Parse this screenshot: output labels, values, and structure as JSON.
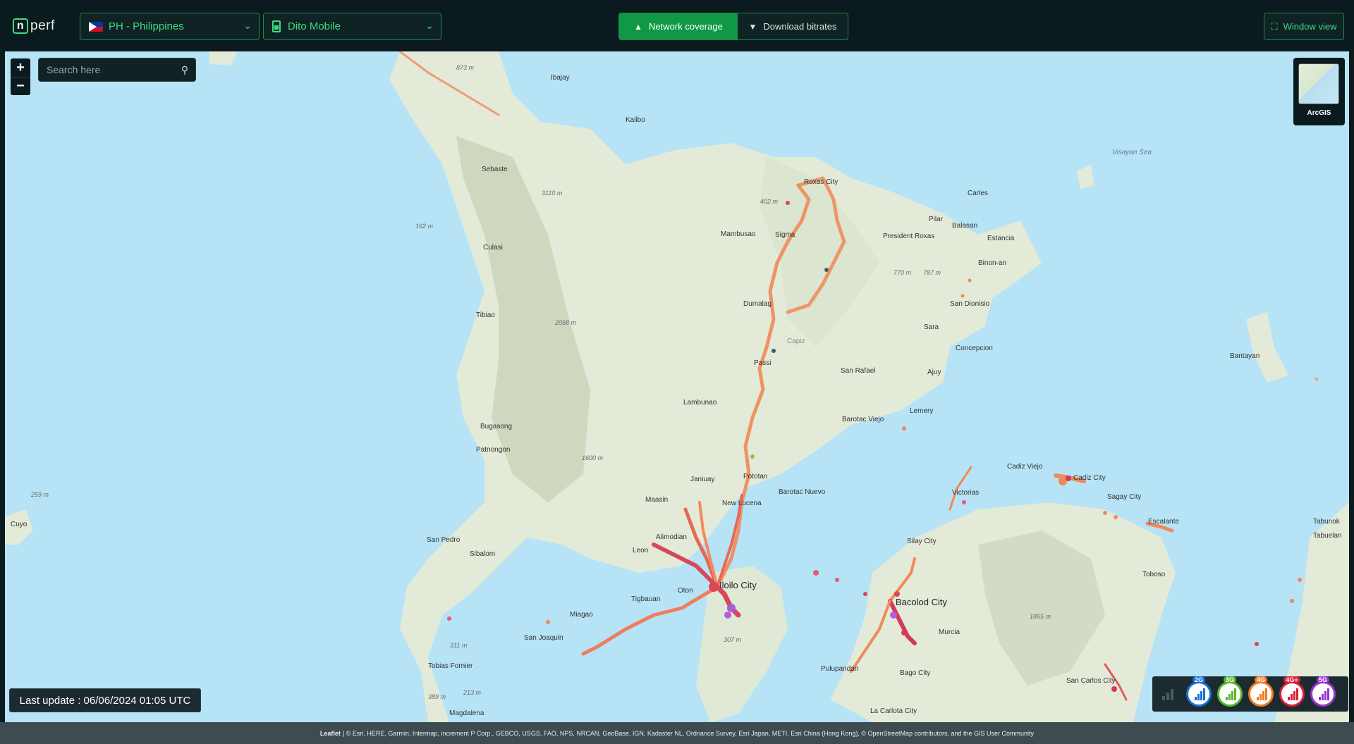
{
  "header": {
    "logo_text": "perf",
    "logo_badge": "n",
    "country_select": "PH - Philippines",
    "operator_select": "Dito Mobile",
    "toggle": [
      {
        "label": "Network coverage",
        "icon": "signal-tower-icon",
        "active": true
      },
      {
        "label": "Download bitrates",
        "icon": "download-circle-icon",
        "active": false
      }
    ],
    "window_view": "Window view"
  },
  "map_controls": {
    "zoom_in": "+",
    "zoom_out": "−",
    "search_placeholder": "Search here",
    "basemap_label": "ArcGIS"
  },
  "last_update": "Last update : 06/06/2024 01:05 UTC",
  "legend": {
    "items": [
      {
        "label": "2G",
        "color": "#1a6fd6"
      },
      {
        "label": "3G",
        "color": "#57b72f"
      },
      {
        "label": "4G",
        "color": "#f07b1c"
      },
      {
        "label": "4G+",
        "color": "#d81f3a"
      },
      {
        "label": "5G",
        "color": "#9b34d3"
      }
    ]
  },
  "map": {
    "places": [
      "Ibajay",
      "Kalibo",
      "Sebaste",
      "Culasi",
      "Tibiao",
      "Bugasong",
      "Patnongon",
      "San Pedro",
      "Sibalom",
      "San Joaquin",
      "Tobias Fornier",
      "Magdalena",
      "Miagao",
      "Tigbauan",
      "Oton",
      "Leon",
      "Alimodian",
      "Maasin",
      "Janiuay",
      "New Lucena",
      "Lambunao",
      "Passi",
      "Dumalag",
      "Mambusao",
      "Sigma",
      "Roxas City",
      "Pilar",
      "President Roxas",
      "Balasan",
      "Carles",
      "Estancia",
      "Binon-an",
      "San Dionisio",
      "Sara",
      "Concepcion",
      "Ajuy",
      "San Rafael",
      "Barotac Viejo",
      "Lemery",
      "Pototan",
      "Barotac Nuevo",
      "Cadiz Viejo",
      "Cadiz City",
      "Sagay City",
      "Escalante",
      "Victorias",
      "Silay City",
      "Murcia",
      "Bago City",
      "Pulupandan",
      "La Carlota City",
      "San Carlos City",
      "Toboso",
      "Tabunok",
      "Tabuelan",
      "Bantayan",
      "Cuyo",
      "Capiz"
    ],
    "major_places": [
      "Iloilo City",
      "Bacolod City"
    ],
    "water": [
      "Visayan Sea"
    ],
    "elevations": [
      "873 m",
      "3110 m",
      "162 m",
      "402 m",
      "770 m",
      "787 m",
      "2058 m",
      "1600 m",
      "259 m",
      "311 m",
      "213 m",
      "389 m",
      "1865 m",
      "307 m"
    ]
  },
  "attribution": {
    "leaflet": "Leaflet",
    "text": "| © Esri, HERE, Garmin, Intermap, increment P Corp., GEBCO, USGS, FAO, NPS, NRCAN, GeoBase, IGN, Kadaster NL, Ordnance Survey, Esri Japan, METI, Esri China (Hong Kong), © OpenStreetMap contributors, and the GIS User Community"
  }
}
